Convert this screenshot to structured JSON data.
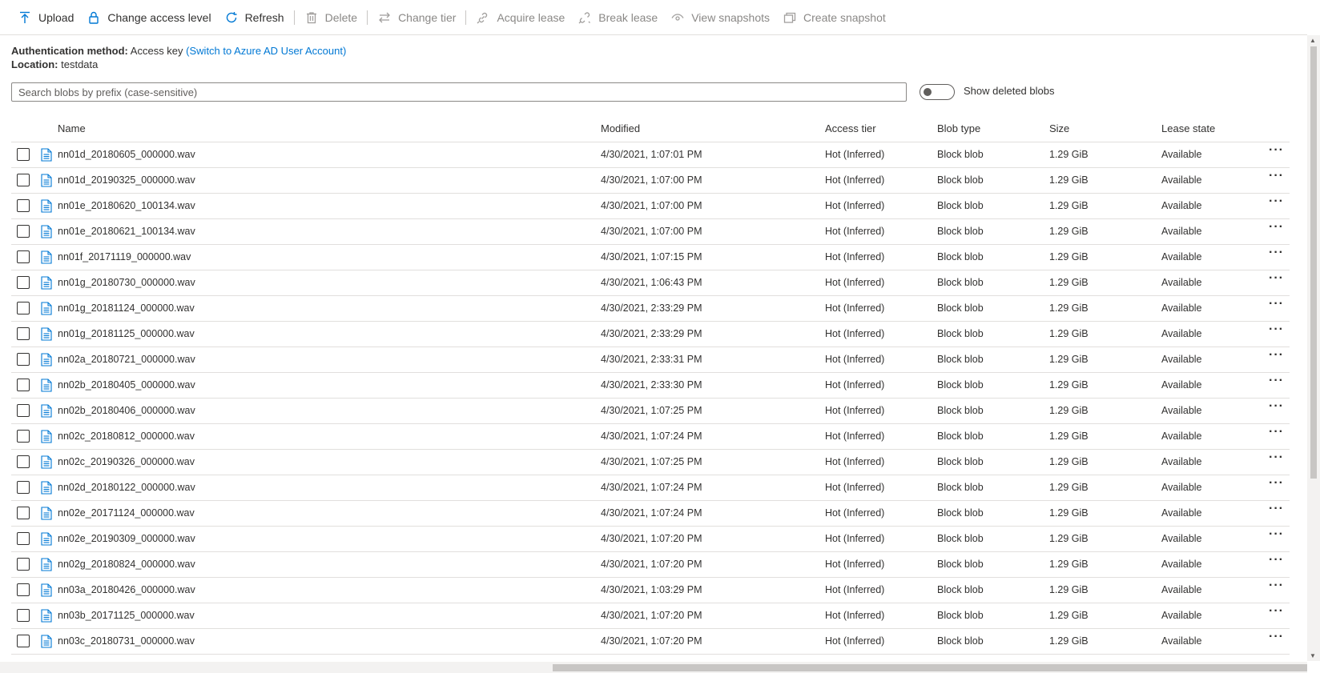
{
  "toolbar": {
    "upload": "Upload",
    "change_access": "Change access level",
    "refresh": "Refresh",
    "delete": "Delete",
    "change_tier": "Change tier",
    "acquire_lease": "Acquire lease",
    "break_lease": "Break lease",
    "view_snapshots": "View snapshots",
    "create_snapshot": "Create snapshot"
  },
  "info": {
    "auth_label": "Authentication method:",
    "auth_value": "Access key",
    "auth_link": "(Switch to Azure AD User Account)",
    "location_label": "Location:",
    "location_value": "testdata"
  },
  "search": {
    "placeholder": "Search blobs by prefix (case-sensitive)"
  },
  "show_deleted": {
    "label": "Show deleted blobs",
    "on": false
  },
  "columns": {
    "name": "Name",
    "modified": "Modified",
    "tier": "Access tier",
    "type": "Blob type",
    "size": "Size",
    "lease": "Lease state"
  },
  "rows": [
    {
      "name": "nn01d_20180605_000000.wav",
      "modified": "4/30/2021, 1:07:01 PM",
      "tier": "Hot (Inferred)",
      "type": "Block blob",
      "size": "1.29 GiB",
      "lease": "Available"
    },
    {
      "name": "nn01d_20190325_000000.wav",
      "modified": "4/30/2021, 1:07:00 PM",
      "tier": "Hot (Inferred)",
      "type": "Block blob",
      "size": "1.29 GiB",
      "lease": "Available"
    },
    {
      "name": "nn01e_20180620_100134.wav",
      "modified": "4/30/2021, 1:07:00 PM",
      "tier": "Hot (Inferred)",
      "type": "Block blob",
      "size": "1.29 GiB",
      "lease": "Available"
    },
    {
      "name": "nn01e_20180621_100134.wav",
      "modified": "4/30/2021, 1:07:00 PM",
      "tier": "Hot (Inferred)",
      "type": "Block blob",
      "size": "1.29 GiB",
      "lease": "Available"
    },
    {
      "name": "nn01f_20171119_000000.wav",
      "modified": "4/30/2021, 1:07:15 PM",
      "tier": "Hot (Inferred)",
      "type": "Block blob",
      "size": "1.29 GiB",
      "lease": "Available"
    },
    {
      "name": "nn01g_20180730_000000.wav",
      "modified": "4/30/2021, 1:06:43 PM",
      "tier": "Hot (Inferred)",
      "type": "Block blob",
      "size": "1.29 GiB",
      "lease": "Available"
    },
    {
      "name": "nn01g_20181124_000000.wav",
      "modified": "4/30/2021, 2:33:29 PM",
      "tier": "Hot (Inferred)",
      "type": "Block blob",
      "size": "1.29 GiB",
      "lease": "Available"
    },
    {
      "name": "nn01g_20181125_000000.wav",
      "modified": "4/30/2021, 2:33:29 PM",
      "tier": "Hot (Inferred)",
      "type": "Block blob",
      "size": "1.29 GiB",
      "lease": "Available"
    },
    {
      "name": "nn02a_20180721_000000.wav",
      "modified": "4/30/2021, 2:33:31 PM",
      "tier": "Hot (Inferred)",
      "type": "Block blob",
      "size": "1.29 GiB",
      "lease": "Available"
    },
    {
      "name": "nn02b_20180405_000000.wav",
      "modified": "4/30/2021, 2:33:30 PM",
      "tier": "Hot (Inferred)",
      "type": "Block blob",
      "size": "1.29 GiB",
      "lease": "Available"
    },
    {
      "name": "nn02b_20180406_000000.wav",
      "modified": "4/30/2021, 1:07:25 PM",
      "tier": "Hot (Inferred)",
      "type": "Block blob",
      "size": "1.29 GiB",
      "lease": "Available"
    },
    {
      "name": "nn02c_20180812_000000.wav",
      "modified": "4/30/2021, 1:07:24 PM",
      "tier": "Hot (Inferred)",
      "type": "Block blob",
      "size": "1.29 GiB",
      "lease": "Available"
    },
    {
      "name": "nn02c_20190326_000000.wav",
      "modified": "4/30/2021, 1:07:25 PM",
      "tier": "Hot (Inferred)",
      "type": "Block blob",
      "size": "1.29 GiB",
      "lease": "Available"
    },
    {
      "name": "nn02d_20180122_000000.wav",
      "modified": "4/30/2021, 1:07:24 PM",
      "tier": "Hot (Inferred)",
      "type": "Block blob",
      "size": "1.29 GiB",
      "lease": "Available"
    },
    {
      "name": "nn02e_20171124_000000.wav",
      "modified": "4/30/2021, 1:07:24 PM",
      "tier": "Hot (Inferred)",
      "type": "Block blob",
      "size": "1.29 GiB",
      "lease": "Available"
    },
    {
      "name": "nn02e_20190309_000000.wav",
      "modified": "4/30/2021, 1:07:20 PM",
      "tier": "Hot (Inferred)",
      "type": "Block blob",
      "size": "1.29 GiB",
      "lease": "Available"
    },
    {
      "name": "nn02g_20180824_000000.wav",
      "modified": "4/30/2021, 1:07:20 PM",
      "tier": "Hot (Inferred)",
      "type": "Block blob",
      "size": "1.29 GiB",
      "lease": "Available"
    },
    {
      "name": "nn03a_20180426_000000.wav",
      "modified": "4/30/2021, 1:03:29 PM",
      "tier": "Hot (Inferred)",
      "type": "Block blob",
      "size": "1.29 GiB",
      "lease": "Available"
    },
    {
      "name": "nn03b_20171125_000000.wav",
      "modified": "4/30/2021, 1:07:20 PM",
      "tier": "Hot (Inferred)",
      "type": "Block blob",
      "size": "1.29 GiB",
      "lease": "Available"
    },
    {
      "name": "nn03c_20180731_000000.wav",
      "modified": "4/30/2021, 1:07:20 PM",
      "tier": "Hot (Inferred)",
      "type": "Block blob",
      "size": "1.29 GiB",
      "lease": "Available"
    }
  ],
  "more_glyph": "···",
  "colors": {
    "accent": "#0078d4",
    "disabled": "#8a8886",
    "border": "#e1dfdd"
  }
}
